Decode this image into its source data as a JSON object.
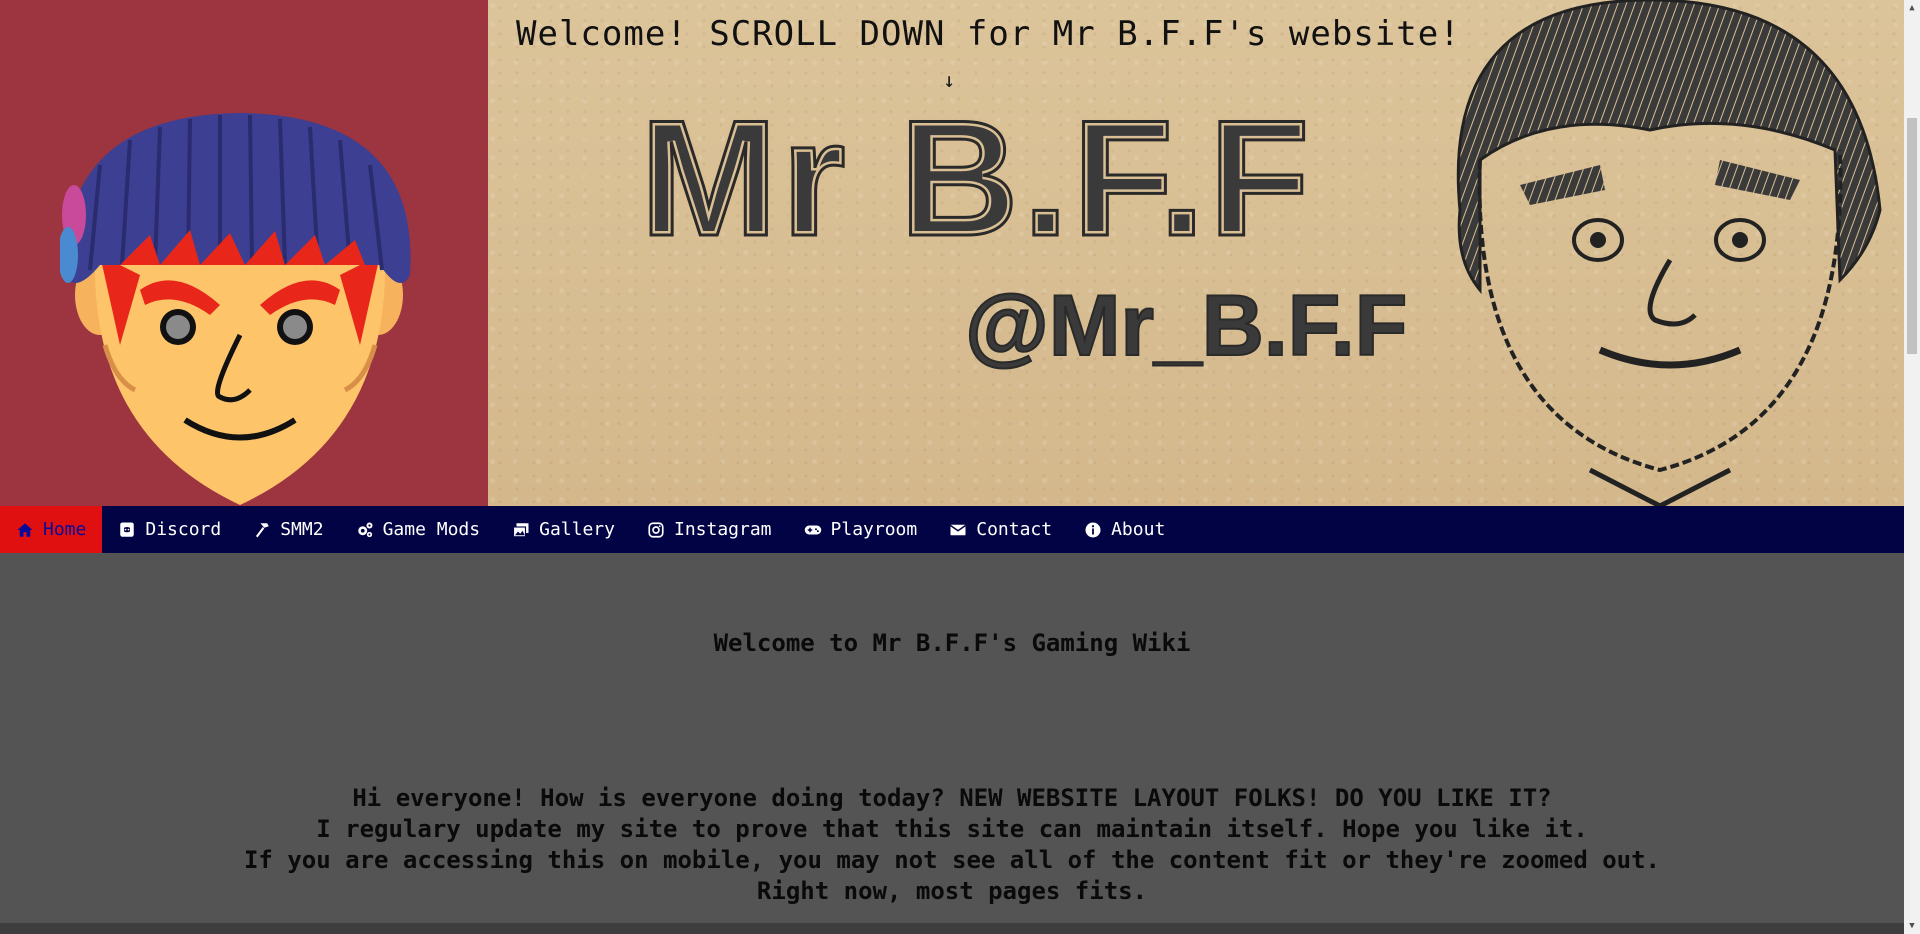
{
  "banner": {
    "welcome": "Welcome! SCROLL DOWN for Mr B.F.F's website!",
    "scroll_arrow": "↓",
    "logo_title": "Mr B.F.F",
    "logo_handle": "@Mr_B.F.F"
  },
  "nav": {
    "items": [
      {
        "label": "Home",
        "icon": "home-icon"
      },
      {
        "label": "Discord",
        "icon": "discord-icon"
      },
      {
        "label": "SMM2",
        "icon": "hammer-icon"
      },
      {
        "label": "Game Mods",
        "icon": "gears-icon"
      },
      {
        "label": "Gallery",
        "icon": "images-icon"
      },
      {
        "label": "Instagram",
        "icon": "instagram-icon"
      },
      {
        "label": "Playroom",
        "icon": "gamepad-icon"
      },
      {
        "label": "Contact",
        "icon": "envelope-icon"
      },
      {
        "label": "About",
        "icon": "info-icon"
      }
    ],
    "active_index": 0
  },
  "main": {
    "title": "Welcome to Mr B.F.F's Gaming Wiki",
    "intro": [
      "Hi everyone! How is everyone doing today? NEW WEBSITE LAYOUT FOLKS! DO YOU LIKE IT?",
      "I regulary update my site to prove that this site can maintain itself. Hope you like it.",
      "If you are accessing this on mobile, you may not see all of the content fit or they're zoomed out.",
      "Right now, most pages fits."
    ]
  },
  "colors": {
    "avatar_bg": "#9c3540",
    "paper": "#d9bf93",
    "nav_bg": "#020344",
    "nav_active": "#e01010",
    "page_bg": "#545454"
  }
}
